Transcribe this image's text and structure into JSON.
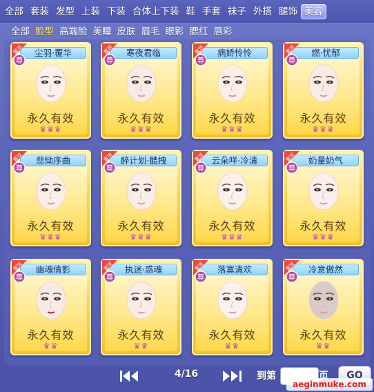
{
  "category_tabs": [
    "全部",
    "套装",
    "发型",
    "上装",
    "下装",
    "合体上下装",
    "鞋",
    "手套",
    "袜子",
    "外搭",
    "腿饰",
    "美容"
  ],
  "active_category": "美容",
  "sub_tabs": [
    "全部",
    "脸型",
    "高端脸",
    "美瞳",
    "皮肤",
    "眉毛",
    "眼影",
    "腮红",
    "唇彩"
  ],
  "active_sub_tab": "脸型",
  "ribbon_top": "置顶",
  "ribbon_badge": "尊",
  "items": [
    {
      "name": "尘羽·覆华",
      "validity": "永久有效",
      "crowns": "♛♛♛"
    },
    {
      "name": "寒夜君临",
      "validity": "永久有效",
      "crowns": "♛♛♛"
    },
    {
      "name": "病娇怜怜",
      "validity": "永久有效",
      "crowns": "♛♛♛"
    },
    {
      "name": "燃·忧郁",
      "validity": "永久有效",
      "crowns": "♛♛♛"
    },
    {
      "name": "悲恸序曲",
      "validity": "永久有效",
      "crowns": "♛♛♛"
    },
    {
      "name": "醉计划·酷拽",
      "validity": "永久有效",
      "crowns": "♛♛♛"
    },
    {
      "name": "云朵咩·冷清",
      "validity": "永久有效",
      "crowns": "♛♛♛"
    },
    {
      "name": "奶量奶气",
      "validity": "永久有效",
      "crowns": "♛♛♛"
    },
    {
      "name": "幽魂倩影",
      "validity": "永久有效",
      "crowns": "♛♛"
    },
    {
      "name": "执迷·惑魂",
      "validity": "永久有效",
      "crowns": "♛♛"
    },
    {
      "name": "落寞清欢",
      "validity": "永久有效",
      "crowns": "♛♛"
    },
    {
      "name": "冷意傲然",
      "validity": "永久有效",
      "crowns": "♛♛"
    }
  ],
  "pagination": {
    "current": "4/16",
    "goto_label": "到第",
    "page_suffix": "页",
    "go_label": "GO"
  },
  "watermark": "aeginmuke.com",
  "colors": {
    "card_gold": "#ffd655",
    "name_blue": "#8ed2f7",
    "ribbon_red": "#e94a3c",
    "bg": "#5660b4"
  }
}
